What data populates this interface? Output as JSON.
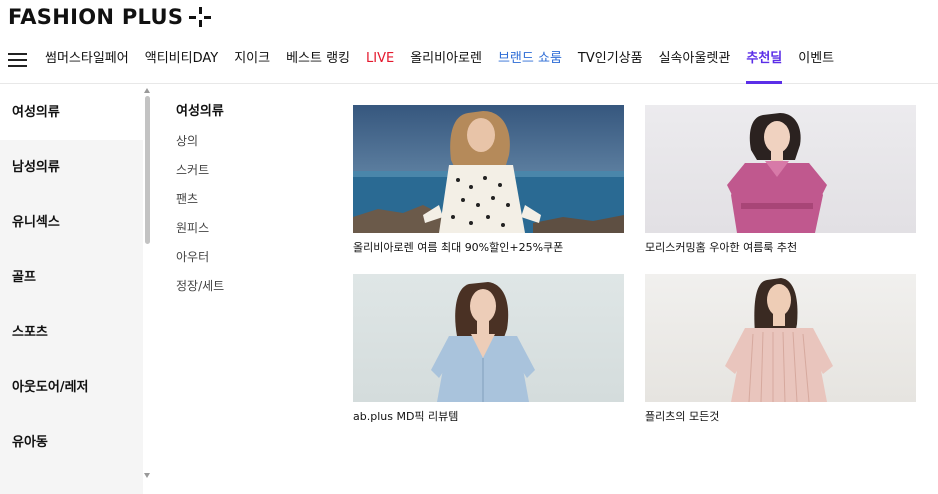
{
  "logo": {
    "text": "FASHION PLUS"
  },
  "gnb": {
    "items": [
      {
        "label": "썸머스타일페어",
        "style": "normal"
      },
      {
        "label": "액티비티DAY",
        "style": "normal"
      },
      {
        "label": "지이크",
        "style": "normal"
      },
      {
        "label": "베스트 랭킹",
        "style": "normal"
      },
      {
        "label": "LIVE",
        "style": "red"
      },
      {
        "label": "올리비아로렌",
        "style": "normal"
      },
      {
        "label": "브랜드 쇼룸",
        "style": "blue"
      },
      {
        "label": "TV인기상품",
        "style": "normal"
      },
      {
        "label": "실속아울렛관",
        "style": "normal"
      },
      {
        "label": "추천딜",
        "style": "active"
      },
      {
        "label": "이벤트",
        "style": "normal"
      }
    ]
  },
  "categories": [
    {
      "label": "여성의류",
      "active": true
    },
    {
      "label": "남성의류",
      "active": false
    },
    {
      "label": "유니섹스",
      "active": false
    },
    {
      "label": "골프",
      "active": false
    },
    {
      "label": "스포츠",
      "active": false
    },
    {
      "label": "아웃도어/레저",
      "active": false
    },
    {
      "label": "유아동",
      "active": false
    }
  ],
  "subcategory": {
    "title": "여성의류",
    "items": [
      "상의",
      "스커트",
      "팬츠",
      "원피스",
      "아우터",
      "정장/세트"
    ]
  },
  "promos": [
    {
      "caption": "올리비아로렌 여름 최대 90%할인+25%쿠폰"
    },
    {
      "caption": "모리스커밍홈 우아한 여름룩 추천"
    },
    {
      "caption": "ab.plus MD픽 리뷰템"
    },
    {
      "caption": "플리츠의 모든것"
    }
  ],
  "colors": {
    "accent": "#5b2ee8",
    "live": "#e4192e",
    "brand_showroom": "#2d6cd6"
  }
}
